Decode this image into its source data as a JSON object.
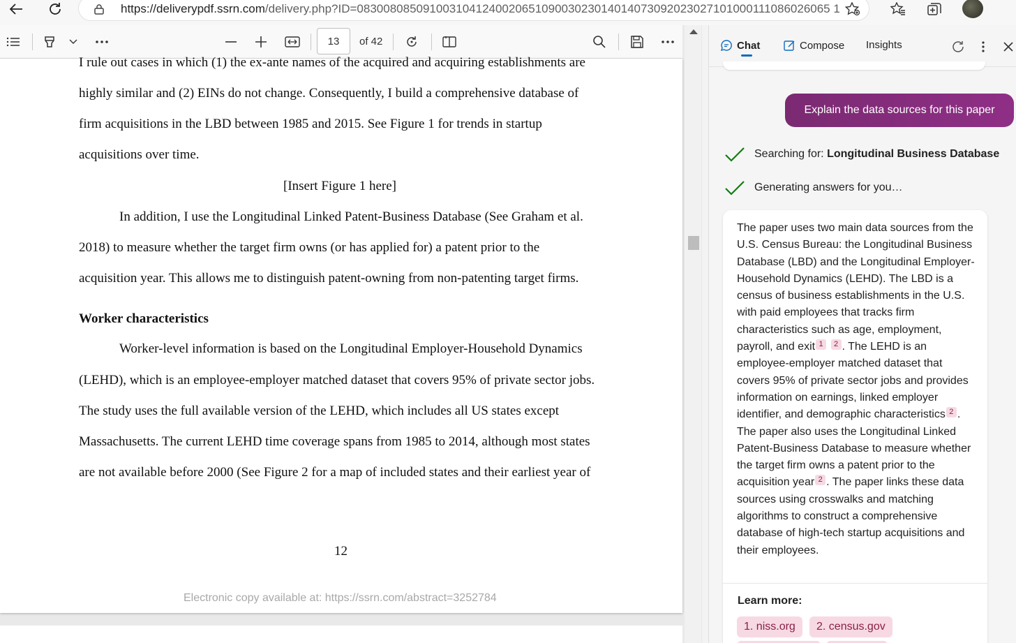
{
  "browser": {
    "url_host": "https://deliverypdf.ssrn.com",
    "url_path": "/delivery.php?ID=083008085091003104124002065109003023014014073092023027101000111086026065 1..."
  },
  "pdf": {
    "current_page": "13",
    "page_total": "of 42",
    "lines": [
      "I rule out cases in which (1) the ex-ante names of the acquired and acquiring establishments are",
      "highly similar and (2) EINs do not change. Consequently, I build a comprehensive database of",
      "firm acquisitions in the LBD between 1985 and 2015. See Figure 1 for trends in startup",
      "acquisitions over time."
    ],
    "insert_figure": "[Insert Figure 1 here]",
    "para2": [
      "In addition, I use the Longitudinal Linked Patent-Business Database (See Graham et al.",
      "2018) to measure whether the target firm owns (or has applied for) a patent prior to the",
      "acquisition year. This allows me to distinguish patent-owning from non-patenting target firms."
    ],
    "heading": "Worker characteristics",
    "para3": [
      "Worker-level information is based on the Longitudinal Employer-Household Dynamics",
      "(LEHD), which is an employee-employer matched dataset that covers 95% of private sector jobs.",
      "The study uses the full available version of the LEHD, which includes all US states except",
      "Massachusetts. The current LEHD time coverage spans from 1985 to 2014, although most states",
      "are not available before 2000 (See Figure 2 for a map of included states and their earliest year of"
    ],
    "page_number": "12",
    "footer": "Electronic copy available at: https://ssrn.com/abstract=3252784"
  },
  "sidebar": {
    "tabs": [
      "Chat",
      "Compose",
      "Insights"
    ],
    "user_message": "Explain the data sources for this paper",
    "status1_prefix": "Searching for: ",
    "status1_query": "Longitudinal Business Database",
    "status2": "Generating answers for you…",
    "answer": {
      "p1": "The paper uses two main data sources from the U.S. Census Bureau: the Longitudinal Business Database (LBD) and the Longitudinal Employer-Household Dynamics (LEHD). The LBD is a census of business establishments in the U.S. with paid employees that tracks firm characteristics such as age, employment, payroll, and exit",
      "c1": "1",
      "c2": "2",
      "p2": ". The LEHD is an employee-employer matched dataset that covers 95% of private sector jobs and provides information on earnings, linked employer identifier, and demographic characteristics",
      "c3": "2",
      "p3": ". The paper also uses the Longitudinal Linked Patent-Business Database to measure whether the target firm owns a patent prior to the acquisition year",
      "c4": "2",
      "p4": ". The paper links these data sources using crosswalks and matching algorithms to construct a comprehensive database of high-tech startup acquisitions and their employees."
    },
    "learn_more": "Learn more:",
    "links": [
      "1. niss.org",
      "2. census.gov"
    ]
  },
  "colors": {
    "accent_purple": "#8f2f86",
    "check_green": "#107c10",
    "citation_bg": "#f7d9e3",
    "tab_underline": "#0f6cbd"
  }
}
